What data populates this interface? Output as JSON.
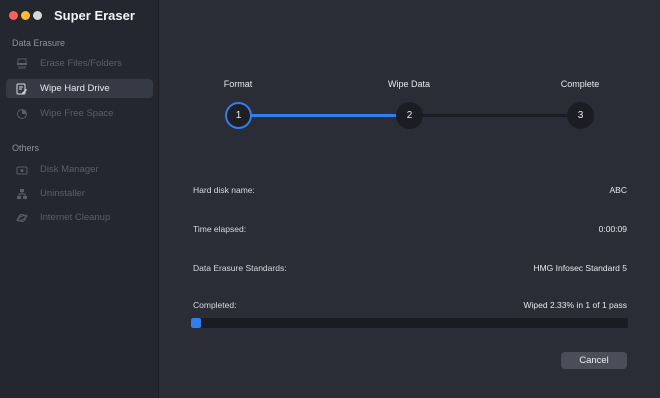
{
  "app": {
    "title": "Super Eraser"
  },
  "sidebar": {
    "sections": [
      {
        "label": "Data Erasure",
        "items": [
          {
            "label": "Erase Files/Folders",
            "icon": "shredder-icon",
            "active": false
          },
          {
            "label": "Wipe Hard Drive",
            "icon": "drive-edit-icon",
            "active": true
          },
          {
            "label": "Wipe Free Space",
            "icon": "pie-chart-icon",
            "active": false
          }
        ]
      },
      {
        "label": "Others",
        "items": [
          {
            "label": "Disk Manager",
            "icon": "disk-icon",
            "active": false
          },
          {
            "label": "Uninstaller",
            "icon": "network-icon",
            "active": false
          },
          {
            "label": "Internet Cleanup",
            "icon": "planet-icon",
            "active": false
          }
        ]
      }
    ]
  },
  "steps": [
    {
      "label": "Format",
      "number": "1",
      "state": "active"
    },
    {
      "label": "Wipe Data",
      "number": "2",
      "state": "current"
    },
    {
      "label": "Complete",
      "number": "3",
      "state": "pending"
    }
  ],
  "details": {
    "disk_name_label": "Hard disk name:",
    "disk_name_value": "ABC",
    "time_label": "Time elapsed:",
    "time_value": "0:00:09",
    "standard_label": "Data Erasure Standards:",
    "standard_value": "HMG Infosec Standard 5",
    "completed_label": "Completed:",
    "completed_value": "Wiped 2.33% in 1 of 1 pass",
    "progress_percent": 2.33
  },
  "actions": {
    "cancel_label": "Cancel"
  },
  "colors": {
    "accent": "#2f7ff0",
    "background": "#2a2d36",
    "sidebar": "#24272f"
  }
}
